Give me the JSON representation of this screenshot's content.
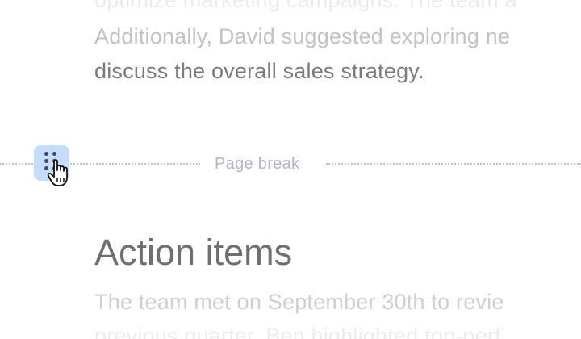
{
  "document": {
    "paragraph_1": {
      "line_1": "optimize marketing campaigns. The team a",
      "line_2": "Additionally, David suggested exploring ne",
      "line_3": "discuss the overall sales strategy."
    },
    "page_break_label": "Page break",
    "heading": "Action items",
    "paragraph_2": {
      "line_1": "The team met on September 30th to revie",
      "line_2": "previous quarter. Ben highlighted top-perf"
    }
  },
  "icons": {
    "drag_handle": "drag-handle-icon",
    "cursor": "grab-hand-cursor-icon"
  },
  "colors": {
    "drag_handle_bg": "#c5dcff",
    "page_break_label": "#b3b3cf",
    "body_text": "#7a7a7a"
  }
}
